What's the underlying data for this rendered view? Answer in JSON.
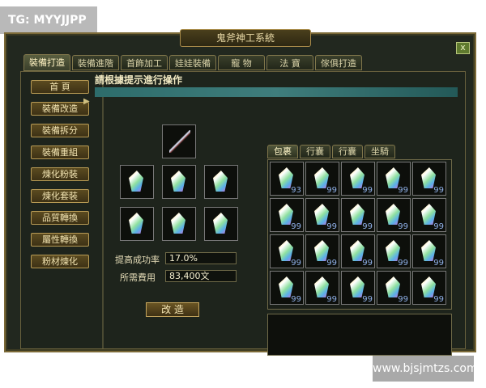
{
  "watermarks": {
    "top": "TG: MYYJJPP",
    "bottom": "www.bjsjmtzs.com"
  },
  "window": {
    "title": "鬼斧神工系統",
    "close_label": "x"
  },
  "tabs": [
    {
      "label": "裝備打造",
      "active": true
    },
    {
      "label": "裝備進階",
      "active": false
    },
    {
      "label": "首飾加工",
      "active": false
    },
    {
      "label": "娃娃裝備",
      "active": false
    },
    {
      "label": "寵 物",
      "active": false
    },
    {
      "label": "法 寶",
      "active": false
    },
    {
      "label": "傢俱打造",
      "active": false
    }
  ],
  "sidebar": [
    {
      "label": "首 頁"
    },
    {
      "label": "裝備改造"
    },
    {
      "label": "裝備拆分"
    },
    {
      "label": "裝備重組"
    },
    {
      "label": "煉化粉裝"
    },
    {
      "label": "煉化套裝"
    },
    {
      "label": "品質轉換"
    },
    {
      "label": "屬性轉換"
    },
    {
      "label": "粉材煉化"
    }
  ],
  "main": {
    "header": "請根據提示進行操作",
    "success_label": "提高成功率",
    "success_value": "17.0%",
    "cost_label": "所需費用",
    "cost_value": "83,400文",
    "forge_button": "改 造"
  },
  "inventory": {
    "tabs": [
      {
        "label": "包裹",
        "active": true
      },
      {
        "label": "行囊",
        "active": false
      },
      {
        "label": "行囊",
        "active": false
      },
      {
        "label": "坐騎",
        "active": false
      }
    ],
    "counts": [
      "93",
      "99",
      "99",
      "99",
      "99",
      "99",
      "99",
      "99",
      "99",
      "99",
      "99",
      "99",
      "99",
      "99",
      "99",
      "99",
      "99",
      "99",
      "99",
      "99"
    ]
  },
  "colors": {
    "gold": "#b89b55",
    "teal": "#2d6c6b",
    "frame": "#7c6a38"
  }
}
